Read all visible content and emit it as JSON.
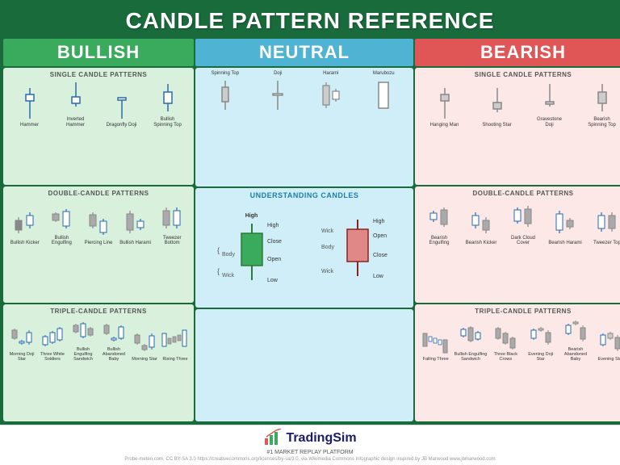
{
  "header": {
    "title": "CANDLE PATTERN REFERENCE"
  },
  "columns": {
    "bullish": {
      "label": "BULLISH",
      "color": "bullish"
    },
    "neutral": {
      "label": "NEUTRAL",
      "color": "neutral"
    },
    "bearish": {
      "label": "BEARISH",
      "color": "bearish"
    }
  },
  "bullish": {
    "single_title": "SINGLE CANDLE PATTERNS",
    "single": [
      {
        "name": "Hammer"
      },
      {
        "name": "Inverted Hammer"
      },
      {
        "name": "Dragonfly Doji"
      },
      {
        "name": "Bullish Spinning Top"
      }
    ],
    "double_title": "DOUBLE-CANDLE PATTERNS",
    "double": [
      {
        "name": "Bullish Kicker"
      },
      {
        "name": "Bullish Engulfing"
      },
      {
        "name": "Piercing Line"
      },
      {
        "name": "Bullish Harami"
      },
      {
        "name": "Tweezer Bottom"
      }
    ],
    "triple_title": "TRIPLE-CANDLE PATTERNS",
    "triple": [
      {
        "name": "Morning Doji Star"
      },
      {
        "name": "Three White Soldiers"
      },
      {
        "name": "Bullish Engulfing Sandwich"
      },
      {
        "name": "Bullish Abandoned Baby"
      },
      {
        "name": "Morning Star"
      },
      {
        "name": "Rising Three"
      }
    ]
  },
  "neutral": {
    "single": [
      {
        "name": "Spinning Top"
      },
      {
        "name": "Doji"
      },
      {
        "name": "Harami"
      },
      {
        "name": "Marubozu"
      }
    ],
    "understanding_title": "UNDERSTANDING CANDLES"
  },
  "bearish": {
    "single_title": "SINGLE CANDLE PATTERNS",
    "single": [
      {
        "name": "Hanging Man"
      },
      {
        "name": "Shooting Star"
      },
      {
        "name": "Gravestone Doji"
      },
      {
        "name": "Bearish Spinning Top"
      }
    ],
    "double_title": "DOUBLE-CANDLE PATTERNS",
    "double": [
      {
        "name": "Bearish Engulfing"
      },
      {
        "name": "Bearish Kicker"
      },
      {
        "name": "Dark Cloud Cover"
      },
      {
        "name": "Bearish Harami"
      },
      {
        "name": "Tweezer Top"
      }
    ],
    "triple_title": "TRIPLE-CANDLE PATTERNS",
    "triple": [
      {
        "name": "Falling Three"
      },
      {
        "name": "Bullish Engulfing Sandwich"
      },
      {
        "name": "Three Black Crows"
      },
      {
        "name": "Evening Doji Star"
      },
      {
        "name": "Bearish Abandoned Baby"
      },
      {
        "name": "Evening Star"
      }
    ]
  },
  "footer": {
    "brand": "TradingSim",
    "tagline": "#1 MARKET REPLAY PLATFORM",
    "attribution": "Probe-meteo.com, CC BY-SA 3.0 https://creativecommons.org/licenses/by-sa/3.0, via Wikimedia Commons    Infographic design inspired by JB Marwood www.jbmarwood.com"
  }
}
